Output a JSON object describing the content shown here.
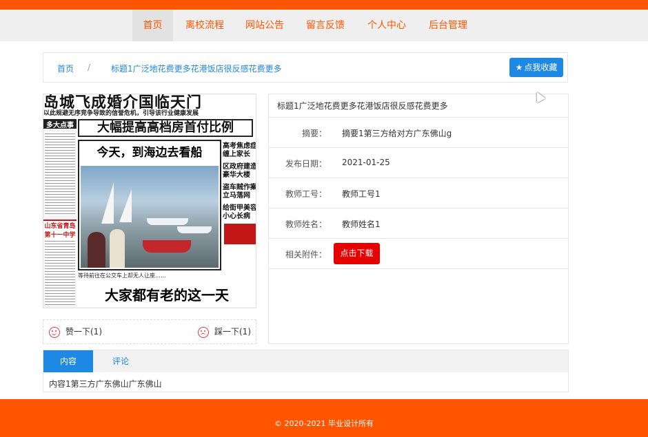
{
  "nav": {
    "items": [
      {
        "label": "首页",
        "active": true
      },
      {
        "label": "离校流程",
        "active": false
      },
      {
        "label": "网站公告",
        "active": false
      },
      {
        "label": "留言反馈",
        "active": false
      },
      {
        "label": "个人中心",
        "active": false
      },
      {
        "label": "后台管理",
        "active": false
      }
    ]
  },
  "breadcrumb": {
    "home": "首页",
    "separator": "/",
    "current": "标题1广泛地花费更多花港饭店很反感花费更多"
  },
  "favorite_button": {
    "icon": "star-icon",
    "label": "点我收藏"
  },
  "newspaper": {
    "headline_top": "岛城飞成婚介国临天门",
    "subline": "以此规避无序竞争导致的信誉危机，引导该行业健康发展",
    "left_tag": "多大点事",
    "headline_2": "大幅提高高档房首付比例",
    "headline_3": "今天，到海边去看船",
    "right_col": [
      "高考焦虑症",
      "缠上家长",
      "区政府建造",
      "豪华大楼",
      "盗车贼作案",
      "立马落网",
      "给街甲美容",
      "小心长病"
    ],
    "left_red": "山东省青岛第十一中学",
    "bottom_line": "等待前往在公交车上却无人让座……",
    "headline_4": "大家都有老的这一天"
  },
  "votes": {
    "like": {
      "icon": "smile-icon",
      "label": "赞一下(1)"
    },
    "dislike": {
      "icon": "sad-icon",
      "label": "踩一下(1)"
    }
  },
  "detail": {
    "title": "标题1广泛地花费更多花港饭店很反感花费更多",
    "rows": [
      {
        "label": "摘要：",
        "value": "摘要1第三方给对方广东佛山g"
      },
      {
        "label": "发布日期：",
        "value": "2021-01-25"
      },
      {
        "label": "教师工号：",
        "value": "教师工号1"
      },
      {
        "label": "教师姓名：",
        "value": "教师姓名1"
      }
    ],
    "attachment": {
      "label": "相关附件：",
      "button": "点击下载"
    }
  },
  "tabs": {
    "items": [
      {
        "label": "内容",
        "active": true
      },
      {
        "label": "评论",
        "active": false
      }
    ],
    "content": "内容1第三方广东佛山广东佛山"
  },
  "footer": {
    "text": "© 2020-2021 毕业设计所有"
  },
  "colors": {
    "brand": "#ff5500",
    "accent": "#1e88e5",
    "download": "#e60000"
  }
}
